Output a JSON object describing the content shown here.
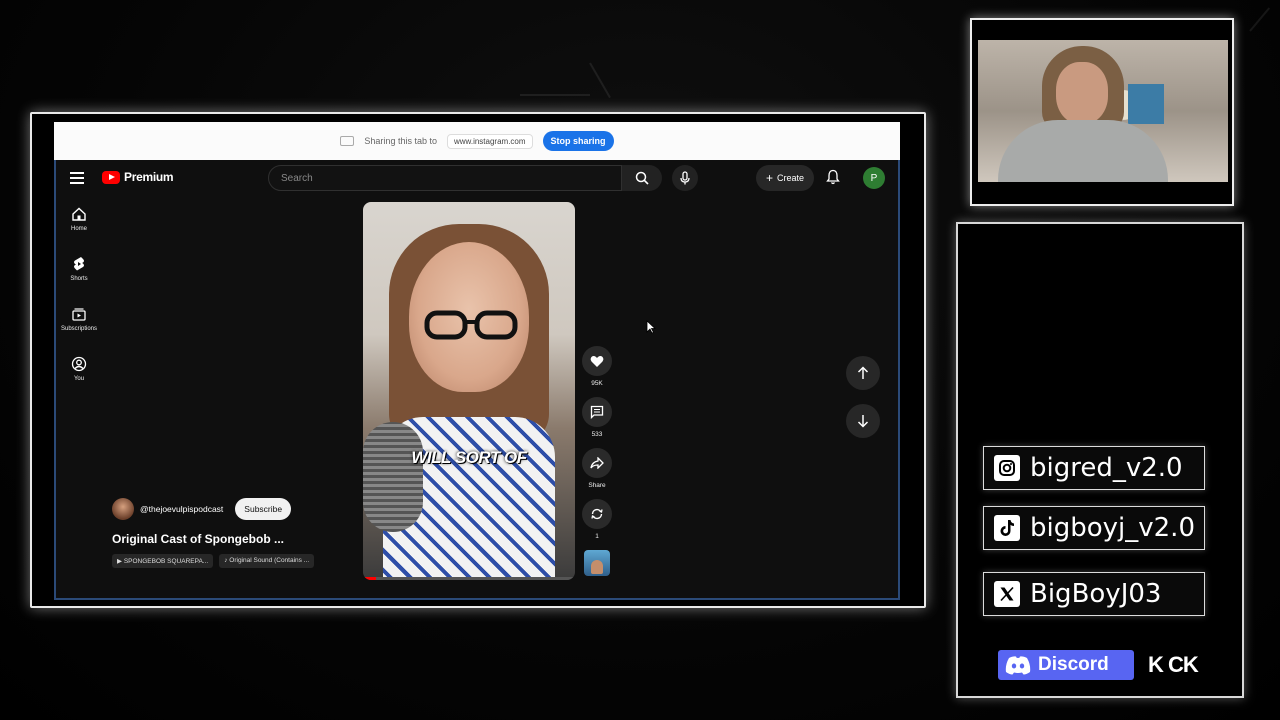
{
  "share_bar": {
    "text": "Sharing this tab to",
    "url": "www.instagram.com",
    "stop_label": "Stop sharing"
  },
  "header": {
    "logo_text": "Premium",
    "search_placeholder": "Search",
    "create_label": "Create",
    "avatar_letter": "P"
  },
  "sidebar": {
    "items": [
      {
        "label": "Home",
        "icon": "home-icon"
      },
      {
        "label": "Shorts",
        "icon": "shorts-icon"
      },
      {
        "label": "Subscriptions",
        "icon": "subscriptions-icon"
      },
      {
        "label": "You",
        "icon": "you-icon"
      }
    ]
  },
  "short": {
    "caption": "WILL SORT OF",
    "progress": 0.06
  },
  "actions": {
    "likes": "95K",
    "comments": "533",
    "share": "Share",
    "remix": "1"
  },
  "video": {
    "channel": "@thejoevulpispodcast",
    "subscribe_label": "Subscribe",
    "title": "Original Cast of Spongebob ...",
    "chip_1": "SPONGEBOB SQUAREPA...",
    "chip_2": "Original Sound (Contains ..."
  },
  "socials": {
    "instagram": "bigred_v2.0",
    "tiktok": "bigboyj_v2.0",
    "x": "BigBoyJ03",
    "discord": "Discord",
    "kick": "K CK"
  },
  "colors": {
    "youtube_red": "#ff0000",
    "share_blue": "#1a73e8",
    "discord_blurple": "#5865f2",
    "avatar_green": "#2e7d32"
  }
}
